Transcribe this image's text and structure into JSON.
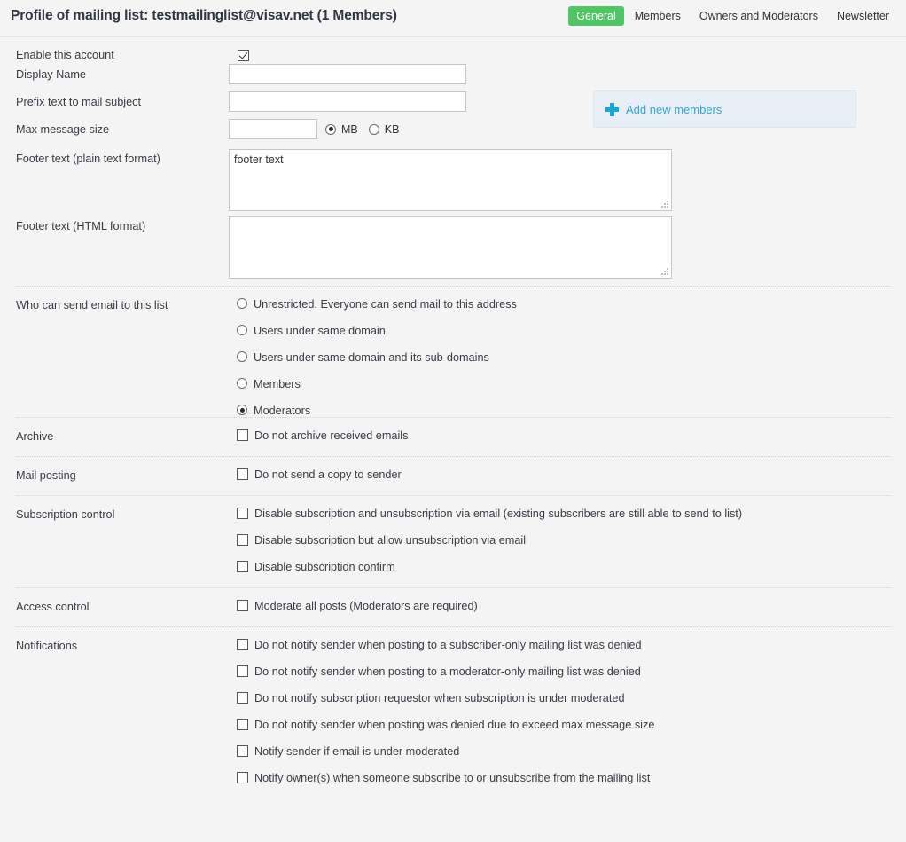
{
  "header": {
    "title": "Profile of mailing list: testmailinglist@visav.net (1 Members)",
    "tabs": [
      {
        "label": "General",
        "active": true
      },
      {
        "label": "Members",
        "active": false
      },
      {
        "label": "Owners and Moderators",
        "active": false
      },
      {
        "label": "Newsletter",
        "active": false
      }
    ],
    "active_tab_color": "#4fc663"
  },
  "side_panel": {
    "icon": "plus-icon",
    "link_label": "Add new members",
    "background": "#e8eff6",
    "link_color": "#2fa6d5"
  },
  "form": {
    "enable_account": {
      "label": "Enable this account",
      "checked": true
    },
    "display_name": {
      "label": "Display Name",
      "value": "",
      "placeholder": ""
    },
    "prefix_subject": {
      "label": "Prefix text to mail subject",
      "value": "",
      "placeholder": ""
    },
    "max_message_size": {
      "label": "Max message size",
      "value": "",
      "placeholder": "",
      "units": [
        {
          "label": "MB",
          "selected": true
        },
        {
          "label": "KB",
          "selected": false
        }
      ]
    },
    "footer_plain": {
      "label": "Footer text (plain text format)",
      "value": "footer text"
    },
    "footer_html": {
      "label": "Footer text (HTML format)",
      "value": ""
    },
    "who_can_send": {
      "label": "Who can send email to this list",
      "options": [
        {
          "label": "Unrestricted. Everyone can send mail to this address",
          "selected": false
        },
        {
          "label": "Users under same domain",
          "selected": false
        },
        {
          "label": "Users under same domain and its sub-domains",
          "selected": false
        },
        {
          "label": "Members",
          "selected": false
        },
        {
          "label": "Moderators",
          "selected": true
        }
      ]
    },
    "archive": {
      "label": "Archive",
      "options": [
        {
          "label": "Do not archive received emails",
          "checked": false
        }
      ]
    },
    "mail_posting": {
      "label": "Mail posting",
      "options": [
        {
          "label": "Do not send a copy to sender",
          "checked": false
        }
      ]
    },
    "subscription_control": {
      "label": "Subscription control",
      "options": [
        {
          "label": "Disable subscription and unsubscription via email (existing subscribers are still able to send to list)",
          "checked": false
        },
        {
          "label": "Disable subscription but allow unsubscription via email",
          "checked": false
        },
        {
          "label": "Disable subscription confirm",
          "checked": false
        }
      ]
    },
    "access_control": {
      "label": "Access control",
      "options": [
        {
          "label": "Moderate all posts (Moderators are required)",
          "checked": false
        }
      ]
    },
    "notifications": {
      "label": "Notifications",
      "options": [
        {
          "label": "Do not notify sender when posting to a subscriber-only mailing list was denied",
          "checked": false
        },
        {
          "label": "Do not notify sender when posting to a moderator-only mailing list was denied",
          "checked": false
        },
        {
          "label": "Do not notify subscription requestor when subscription is under moderated",
          "checked": false
        },
        {
          "label": "Do not notify sender when posting was denied due to exceed max message size",
          "checked": false
        },
        {
          "label": "Notify sender if email is under moderated",
          "checked": false
        },
        {
          "label": "Notify owner(s) when someone subscribe to or unsubscribe from the mailing list",
          "checked": false
        }
      ]
    }
  }
}
